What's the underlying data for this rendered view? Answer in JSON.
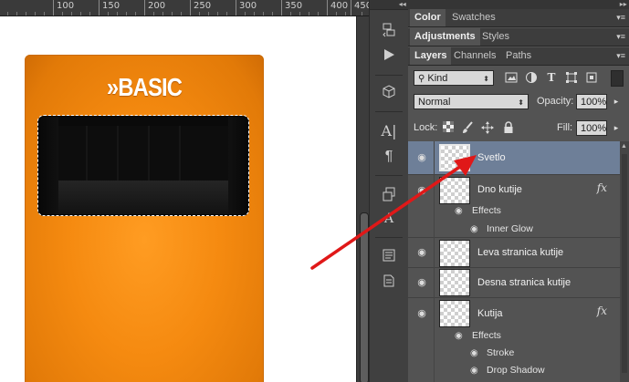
{
  "ruler": {
    "ticks": [
      "100",
      "150",
      "200",
      "250",
      "300",
      "350",
      "400",
      "450"
    ]
  },
  "card": {
    "title": "»BASIC"
  },
  "panels": {
    "group1_tabs": [
      "Color",
      "Swatches"
    ],
    "group2_tabs": [
      "Adjustments",
      "Styles"
    ],
    "group3_tabs": [
      "Layers",
      "Channels",
      "Paths"
    ],
    "filter": {
      "value": "Kind",
      "icon": "search-icon"
    },
    "blend_mode": "Normal",
    "opacity_label": "Opacity:",
    "opacity_value": "100%",
    "lock_label": "Lock:",
    "fill_label": "Fill:",
    "fill_value": "100%"
  },
  "layers": [
    {
      "name": "Svetlo",
      "selected": true
    },
    {
      "name": "Dno kutije",
      "fx": "fx",
      "effects_label": "Effects",
      "effects": [
        "Inner Glow"
      ]
    },
    {
      "name": "Leva stranica kutije"
    },
    {
      "name": "Desna stranica kutije"
    },
    {
      "name": "Kutija",
      "fx": "fx",
      "effects_label": "Effects",
      "effects": [
        "Stroke",
        "Drop Shadow"
      ]
    }
  ],
  "colors": {
    "selected_layer": "#6e7f98",
    "card_orange": "#f58a10",
    "annotation_arrow": "#e01818"
  }
}
